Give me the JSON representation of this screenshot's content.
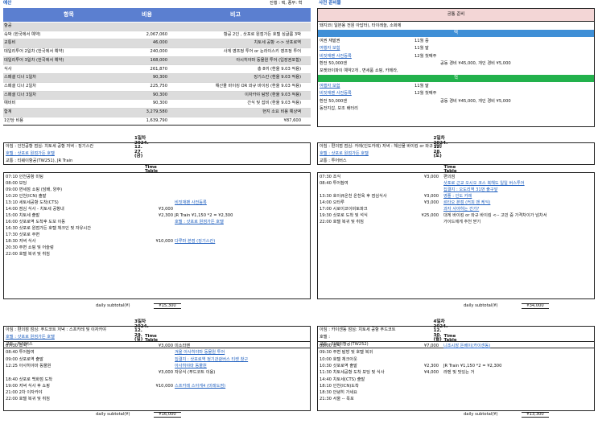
{
  "header": {
    "budget_label": "예산",
    "progress": "진행 : 택, 종무: 혁",
    "prep_label": "사전 준비물"
  },
  "budget": {
    "cols": [
      "항목",
      "비용",
      "비고"
    ],
    "rows": [
      {
        "item": "항공",
        "cost": "",
        "note": "",
        "style": "shaded"
      },
      {
        "item": "숙박 (한국에서 예약)",
        "cost": "2,067,060",
        "note": "항공 2인 , 삿포로 원점가든 호텔 싱글룸 3박",
        "style": ""
      },
      {
        "item": "교통비",
        "cost": "46,000",
        "note": "치토세 공항 <-> 삿포로역",
        "style": "shaded"
      },
      {
        "item": "데일리투어 2일차 (한국에서 예약)",
        "cost": "240,000",
        "note": "사계 영조정 투어 or 눈라이스키 영조정 투어",
        "style": ""
      },
      {
        "item": "데일리투어 3일차 (한국에서 예약)",
        "cost": "168,000",
        "note": "아시히야마 동물원 투어 (입장권포함)",
        "style": "shaded"
      },
      {
        "item": "식사",
        "cost": "261,870",
        "note": "총 8끼 (환율 9.03 적용)",
        "style": ""
      },
      {
        "item": "스페셜 디너 1일차",
        "cost": "90,300",
        "note": "징기스칸 (환율 9.03 적용)",
        "style": "shaded"
      },
      {
        "item": "스페셜 디너 2일차",
        "cost": "225,750",
        "note": "해산물 바이킹 OR 와규 바이킹 (환율 9.03 적용)",
        "style": ""
      },
      {
        "item": "스페셜 디너 3일차",
        "cost": "90,300",
        "note": "이자카야 탐방 (환율 9.03 적용)",
        "style": "shaded"
      },
      {
        "item": "예비비",
        "cost": "90,300",
        "note": "간식 및 잡비 (환율 9.03 적용)",
        "style": ""
      },
      {
        "item": "합계",
        "cost": "3,279,580",
        "note": "현지 소요 비용 예상액",
        "style": "shaded"
      },
      {
        "item": "1인당 비용",
        "cost": "1,639,790",
        "note": "¥87,600",
        "style": "total"
      }
    ]
  },
  "prep": {
    "common_title": "공통 준비",
    "common_line": "돼지코( 일본용 전원 아답터), 타이레놀, 소화제",
    "taek_title": "택",
    "taek_rows": [
      {
        "a": "여권 재발권",
        "b": "11월 중",
        "c": "",
        "link": false
      },
      {
        "a": "여행자 보험",
        "b": "11월 말",
        "c": "",
        "link": true
      },
      {
        "a": "비짓재팬 사전등록",
        "b": "12월 첫째주",
        "c": "",
        "link": true
      },
      {
        "a": "환전 50,000엔",
        "b": "",
        "c": "공동 경비 ¥45,000, 개인 경비 ¥5,000",
        "link": false
      },
      {
        "a": "포켓와이파이 예약2개 , 면세품 쇼핑, 카메라,",
        "b": "",
        "c": "",
        "link": false
      }
    ],
    "hyuk_title": "혁",
    "hyuk_rows": [
      {
        "a": "여행자 보험",
        "b": "11월 말",
        "c": "",
        "link": true
      },
      {
        "a": "비짓재팬 사전등록",
        "b": "12월 첫째주",
        "c": "",
        "link": true
      },
      {
        "a": "환전 50,000엔",
        "b": "",
        "c": "공동 경비 ¥45,000, 개인 경비 ¥5,000",
        "link": false
      },
      {
        "a": "동전지갑, 보조 배터리",
        "b": "",
        "c": "",
        "link": false
      }
    ]
  },
  "days": [
    {
      "title": "1일차 2024. 12. 27.(금)",
      "info1": "아침 : 인천공항          점심: 치토세 공항          저녁 : 징기스칸",
      "info2": "호텔 : 삿포로 원점가든 호텔",
      "info3": "교통 : 티웨이항공(TW251),          JR Train",
      "tt_title": "Time Table",
      "rows": [
        {
          "t": "07:10  인천공항 미팅",
          "p": "",
          "n": "",
          "nl": false
        },
        {
          "t": "08:00  보딩",
          "p": "",
          "n": "",
          "nl": false
        },
        {
          "t": "09:00  면세점 쇼핑 (담배, 양주)",
          "p": "",
          "n": "",
          "nl": false
        },
        {
          "t": "10:20  인천(ICN) 출발",
          "p": "",
          "n": "",
          "nl": false
        },
        {
          "t": "13:10  세토세공항 도착(CTS)",
          "p": "",
          "n": "비짓재팬 사전등록",
          "nl": true
        },
        {
          "t": "14:00  점심 식사 - 치토세 공항내",
          "p": "¥3,000",
          "n": "",
          "nl": false
        },
        {
          "t": "15:00  치토세 출발",
          "p": "¥2,300",
          "n": "JR Train ¥1,150 *2 = ¥2,300",
          "nl": false
        },
        {
          "t": "16:00  삿포로역 도착후 도보 이동",
          "p": "",
          "n": "호텔 : 삿포로 원점가든 호텔",
          "nl": true
        },
        {
          "t": "16:30  삿포로 원점가든 호텔 체크인 및 자유시간",
          "p": "",
          "n": "",
          "nl": false
        },
        {
          "t": "17:30  삿포로 주변",
          "p": "",
          "n": "",
          "nl": false
        },
        {
          "t": "18:30  저녁 식사",
          "p": "¥10,000",
          "n": "다루마 본점 (징기스칸)",
          "nl": true
        },
        {
          "t": "20:30  주변 쇼핑 및 어슬렁",
          "p": "",
          "n": "",
          "nl": false
        },
        {
          "t": "22:00  호텔 복귀 및 취침",
          "p": "",
          "n": "",
          "nl": false
        }
      ],
      "subtotal_label": "daily subtotal(¥)",
      "subtotal": "¥15,300"
    },
    {
      "title": "2일차 2024. 12. 28.(토)",
      "info1": "아침 : 편의점          점심: 카레(인도카레)          저녁 : 해산물 바이킹 or 와규 뷔페",
      "info2": "호텔 : 삿포로 원점가든 호텔",
      "info3": "교통 : 투어버스",
      "tt_title": "Time Table",
      "rows": [
        {
          "t": "07:30  조식",
          "p": "¥3,000",
          "n": "편의점",
          "nl": false
        },
        {
          "t": "08:40  투어참여",
          "p": "",
          "n": "삿포로 근교 오시오 코스 북해도 일일 버스투어",
          "nl": true
        },
        {
          "t": "",
          "p": "",
          "n": "집결지 : 오도리역 31번 출구앞",
          "nl": true
        },
        {
          "t": "13:30  호이큐온천 온천욕 후 점심식사",
          "p": "¥3,000",
          "n": "영플 : 인도 카레",
          "nl": true
        },
        {
          "t": "14:00  오타루",
          "p": "¥3,000",
          "n": "르타오 본점 (커피 맨 케익)",
          "nl": true
        },
        {
          "t": "17:00  시로이코이비토파크",
          "p": "",
          "n": "과자 사야하는 건가?",
          "nl": true
        },
        {
          "t": "19:30  삿포로 도착 및 석식",
          "p": "¥25,000",
          "n": "대게 바이킹 or 와규 바이킹 <-- 고민 중 가격차이가 넘차서",
          "nl": false
        },
        {
          "t": "22:00  호텔 복귀 및 취침",
          "p": "",
          "n": "가이드에게 추천 받기",
          "nl": false
        }
      ],
      "subtotal_label": "daily subtotal(¥)",
      "subtotal": "¥34,000"
    },
    {
      "title": "3일차 2024. 12. 29.(일)",
      "info1": "아침 : 편의점          점심: 푸드코트          저녁 : 스프카레 및 이자카야",
      "info2": "호텔 : 삿포로 원점가든 호텔",
      "info3": "교통 : 투어버스",
      "tt_title": "Time Table",
      "rows": [
        {
          "t": "07:30  조식",
          "p": "¥3,000",
          "n": "미소라멘",
          "nl": false
        },
        {
          "t": "08:40  투어참여",
          "p": "",
          "n": "겨울 아사히야마 동물원 투어",
          "nl": true
        },
        {
          "t": "09:00  삿포로역 출발",
          "p": "",
          "n": "집결지 : 삿포로역 정기관광버스 티켓 창구",
          "nl": true
        },
        {
          "t": "12:25  아사히야마 동물원",
          "p": "",
          "n": "아사히야마 동물원",
          "nl": true
        },
        {
          "t": "",
          "p": "¥3,000",
          "n": "자유식 (푸드코트 이용)",
          "nl": false
        },
        {
          "t": "18:40  삿포로 백화점 도착",
          "p": "",
          "n": "",
          "nl": false
        },
        {
          "t": "19:00  저녁 식사 후 쇼핑",
          "p": "¥10,000",
          "n": "스프카레 스아게4 (미레도점)",
          "nl": true
        },
        {
          "t": "21:00  2차 이자카야",
          "p": "",
          "n": "",
          "nl": false
        },
        {
          "t": "22:00  호텔 복귀 및 취침",
          "p": "",
          "n": "",
          "nl": false
        }
      ],
      "subtotal_label": "daily subtotal(¥)",
      "subtotal": "¥16,000"
    },
    {
      "title": "4일차 2024. 12. 30.(월)",
      "info1": "아침 : 카이센동          점심: 치토세 공항 푸드코트",
      "info2": "호텔 :",
      "info3": "교통 : 티웨이항공(TW252)",
      "tt_title": "Time Table",
      "rows": [
        {
          "t": "08:00  조식",
          "p": "¥7,000",
          "n": "니조시장 돈베이(카이센동)",
          "nl": true
        },
        {
          "t": "09:30  주변 탐방 및 호텔 복귀",
          "p": "",
          "n": "",
          "nl": false
        },
        {
          "t": "10:00  호텔 체크아웃",
          "p": "",
          "n": "",
          "nl": false
        },
        {
          "t": "10:30  삿포로역 출발",
          "p": "¥2,300",
          "n": "JR Train ¥1,150 *2 = ¥2,300",
          "nl": false
        },
        {
          "t": "11:30  치토세공항 도착 보딩 및 식사",
          "p": "¥4,000",
          "n": "라멘 및 맛있는 거",
          "nl": false
        },
        {
          "t": "14:40  치토세(CTS) 출발",
          "p": "",
          "n": "",
          "nl": false
        },
        {
          "t": "18:10  인천(ICN)도착",
          "p": "",
          "n": "",
          "nl": false
        },
        {
          "t": "18:30  안녕히 가세요",
          "p": "",
          "n": "",
          "nl": false
        },
        {
          "t": "21:30  서울 -- 목포",
          "p": "",
          "n": "",
          "nl": false
        }
      ],
      "subtotal_label": "daily subtotal(¥)",
      "subtotal": "¥13,300"
    }
  ],
  "colors": {
    "header_blue": "#5b7fd0",
    "taek_bar": "#3f8fd6",
    "hyuk_bar": "#22b14c",
    "common_bar": "#f3d6d6",
    "link": "#1f5fbf"
  }
}
